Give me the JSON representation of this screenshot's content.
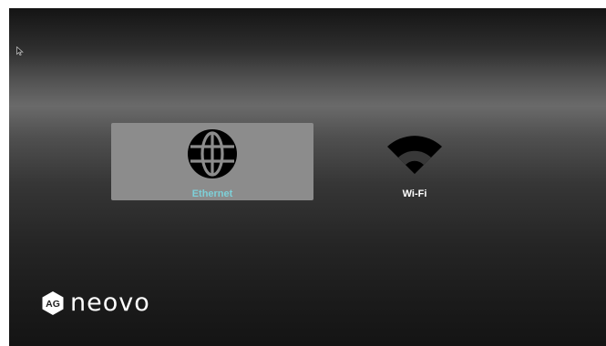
{
  "network_menu": {
    "options": [
      {
        "id": "ethernet",
        "label": "Ethernet",
        "icon": "globe-icon",
        "selected": true,
        "label_color": "#7ed0d8"
      },
      {
        "id": "wifi",
        "label": "Wi-Fi",
        "icon": "wifi-icon",
        "selected": false,
        "label_color": "#ffffff"
      }
    ]
  },
  "brand": {
    "badge_text": "AG",
    "wordmark": "neovo"
  },
  "colors": {
    "selected_tile": "#8c8c8c",
    "background_dark": "#141414",
    "background_band": "#6a6a6a"
  }
}
